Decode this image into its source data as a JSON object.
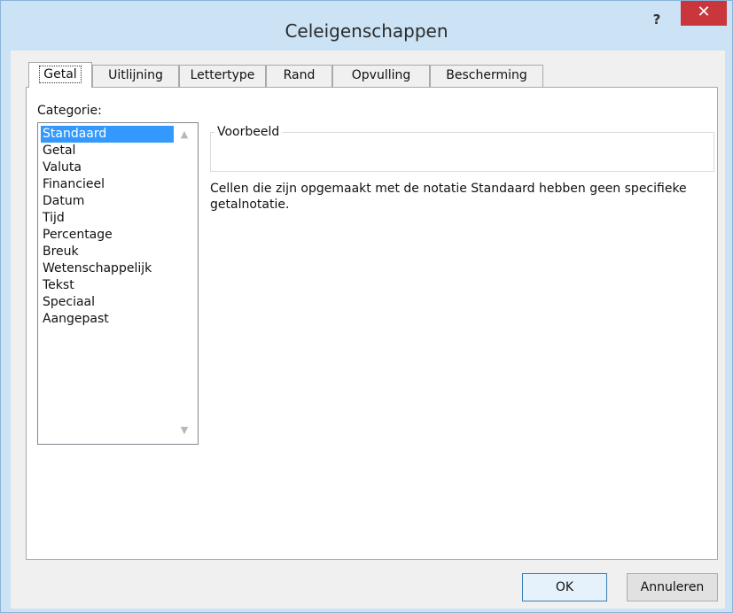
{
  "window": {
    "title": "Celeigenschappen",
    "help_label": "?",
    "close_label": "✕"
  },
  "tabs": [
    {
      "label": "Getal",
      "active": true
    },
    {
      "label": "Uitlijning",
      "active": false
    },
    {
      "label": "Lettertype",
      "active": false
    },
    {
      "label": "Rand",
      "active": false
    },
    {
      "label": "Opvulling",
      "active": false
    },
    {
      "label": "Bescherming",
      "active": false
    }
  ],
  "category": {
    "label": "Categorie:",
    "items": [
      "Standaard",
      "Getal",
      "Valuta",
      "Financieel",
      "Datum",
      "Tijd",
      "Percentage",
      "Breuk",
      "Wetenschappelijk",
      "Tekst",
      "Speciaal",
      "Aangepast"
    ],
    "selected": "Standaard",
    "scroll_up_icon": "▲",
    "scroll_down_icon": "▼"
  },
  "preview": {
    "title": "Voorbeeld",
    "value": ""
  },
  "description": "Cellen die zijn opgemaakt met de notatie Standaard hebben geen specifieke getalnotatie.",
  "buttons": {
    "ok": "OK",
    "cancel": "Annuleren"
  },
  "colors": {
    "frame": "#cbe3f5",
    "close": "#c9363c",
    "selection": "#3399ff"
  }
}
